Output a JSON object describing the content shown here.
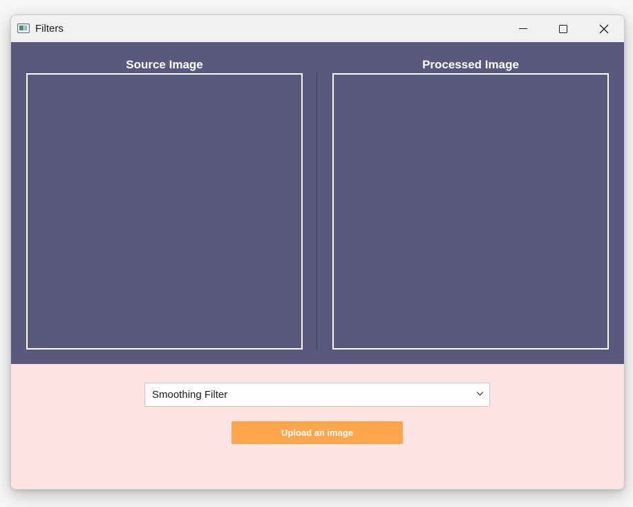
{
  "window": {
    "title": "Filters",
    "icons": {
      "app": "window-app-icon",
      "minimize": "minimize-icon",
      "maximize": "maximize-icon",
      "close": "close-icon"
    }
  },
  "panels": {
    "source_label": "Source Image",
    "processed_label": "Processed Image"
  },
  "controls": {
    "filter_select_value": "Smoothing Filter",
    "upload_label": "Upload an image"
  },
  "colors": {
    "top_panel": "#5a587e",
    "bottom_panel": "#fde4e4",
    "upload_button": "#ffa64d"
  }
}
